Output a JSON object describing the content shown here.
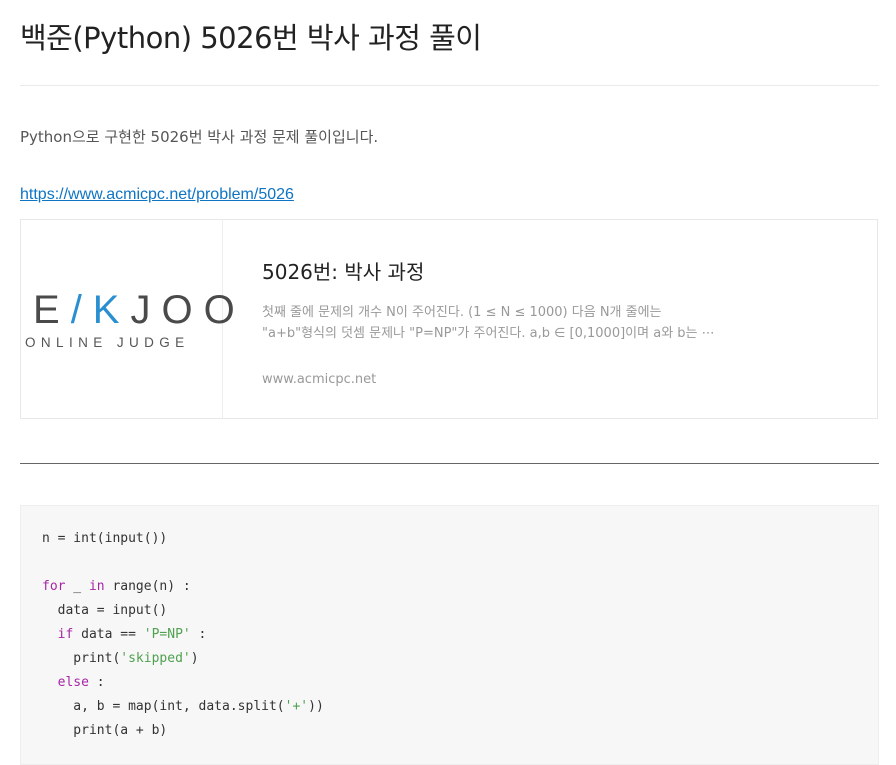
{
  "post": {
    "title": "백준(Python) 5026번 박사 과정 풀이",
    "intro": "Python으로 구현한 5026번 박사 과정 문제 풀이입니다.",
    "link": "https://www.acmicpc.net/problem/5026"
  },
  "link_card": {
    "logo_text_left": "E",
    "logo_text_accent": "/K",
    "logo_text_right": "JOO",
    "logo_subtext": "ONLINE JUDGE",
    "title": "5026번: 박사 과정",
    "description_line1": "첫째 줄에 문제의 개수 N이 주어진다. (1 ≤ N ≤ 1000) 다음 N개 줄에는",
    "description_line2": "\"a+b\"형식의 덧셈 문제나 \"P=NP\"가 주어진다. a,b ∈ [0,1000]이며 a와 b는 ⋯",
    "domain": "www.acmicpc.net"
  },
  "code": {
    "line1": "n = int(input())",
    "line3_kw1": "for",
    "line3_mid": " _ ",
    "line3_kw2": "in",
    "line3_rest": " range(n) :",
    "line4": "  data = input()",
    "line5_indent": "  ",
    "line5_kw": "if",
    "line5_mid": " data == ",
    "line5_str": "'P=NP'",
    "line5_rest": " :",
    "line6_pre": "    print(",
    "line6_str": "'skipped'",
    "line6_post": ")",
    "line7_indent": "  ",
    "line7_kw": "else",
    "line7_rest": " :",
    "line8_pre": "    a, b = map(int, data.split(",
    "line8_str": "'+'",
    "line8_post": "))",
    "line9": "    print(a + b)"
  },
  "colors": {
    "link": "#0e74c4",
    "keyword": "#a626a4",
    "string": "#50a14f",
    "logo_accent": "#2a8fd1"
  }
}
